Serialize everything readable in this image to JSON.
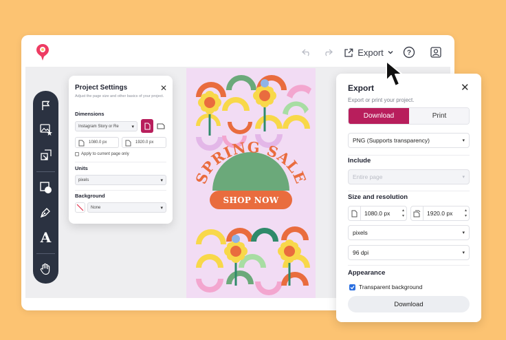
{
  "topbar": {
    "export_label": "Export",
    "icons": [
      "logo-icon",
      "undo-icon",
      "redo-icon",
      "export-icon",
      "chevron-down-icon",
      "help-icon",
      "account-icon"
    ]
  },
  "toolbar": {
    "tools": [
      "flag-icon",
      "image-star-icon",
      "resize-icon",
      "shape-icon",
      "pen-icon",
      "text-icon",
      "hand-icon"
    ],
    "text_tool_label": "A"
  },
  "project_settings": {
    "title": "Project Settings",
    "subtitle": "Adjust the page size and other basics of your project.",
    "dimensions_heading": "Dimensions",
    "preset_value": "Instagram Story or Re",
    "width_value": "1080.0 px",
    "height_value": "1920.0 px",
    "apply_label": "Apply to current page only",
    "units_heading": "Units",
    "units_value": "pixels",
    "background_heading": "Background",
    "background_value": "None"
  },
  "poster": {
    "headline": "SPRING SALE",
    "cta": "SHOP NOW",
    "colors": {
      "bg": "#F2DCF4",
      "orange": "#E96C3E",
      "green": "#6BA97A",
      "yellow": "#F8D84A",
      "blue": "#8FB3E6"
    }
  },
  "export_panel": {
    "title": "Export",
    "subtitle": "Export or print your project.",
    "tab_download": "Download",
    "tab_print": "Print",
    "format_value": "PNG (Supports transparency)",
    "include_heading": "Include",
    "include_value": "Entire page",
    "size_heading": "Size and resolution",
    "width_value": "1080.0 px",
    "height_value": "1920.0 px",
    "units_value": "pixels",
    "dpi_value": "96 dpi",
    "appearance_heading": "Appearance",
    "transparent_label": "Transparent background",
    "download_button": "Download"
  },
  "colors": {
    "background": "#FCC372",
    "accent": "#B81E5C",
    "toolbar": "#2b3241"
  }
}
